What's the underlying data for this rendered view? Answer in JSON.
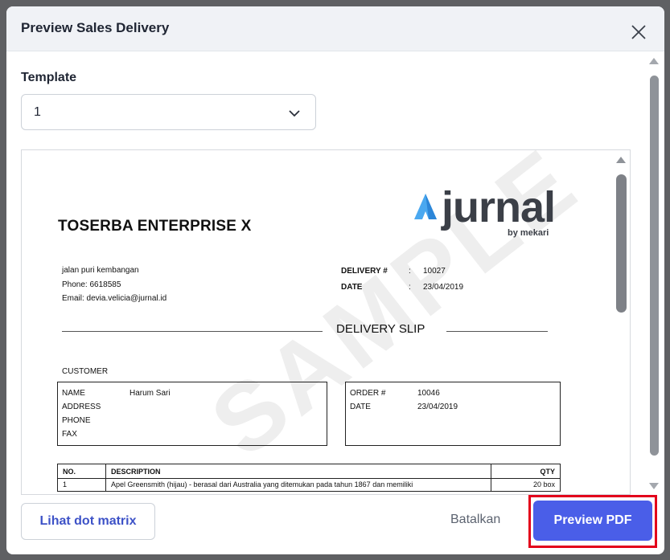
{
  "modal": {
    "title": "Preview Sales Delivery"
  },
  "template": {
    "label": "Template",
    "selected": "1"
  },
  "document": {
    "company": "TOSERBA ENTERPRISE X",
    "logo_word": "jurnal",
    "logo_by": "by mekari",
    "address_lines": [
      "jalan puri kembangan",
      "Phone: 6618585",
      "Email: devia.velicia@jurnal.id"
    ],
    "delivery_no_label": "DELIVERY #",
    "delivery_no": "10027",
    "date_label": "DATE",
    "date": "23/04/2019",
    "colon": ":",
    "slip_title": "DELIVERY SLIP",
    "watermark": "SAMPLE",
    "customer_label": "CUSTOMER",
    "customer": {
      "name_label": "NAME",
      "name": "Harum Sari",
      "address_label": "ADDRESS",
      "phone_label": "PHONE",
      "fax_label": "FAX"
    },
    "order": {
      "order_label": "ORDER #",
      "order_no": "10046",
      "date_label": "DATE",
      "date": "23/04/2019"
    },
    "table": {
      "headers": [
        "NO.",
        "DESCRIPTION",
        "QTY"
      ],
      "rows": [
        [
          "1",
          "Apel Greensmith (hijau) -  berasal dari Australia yang ditemukan pada tahun 1867 dan memiliki",
          "20 box"
        ]
      ]
    }
  },
  "footer": {
    "dot_matrix_label": "Lihat dot matrix",
    "cancel_label": "Batalkan",
    "preview_pdf_label": "Preview PDF"
  },
  "colors": {
    "primary": "#4a5ee8",
    "highlight": "#e3001b",
    "logo_accent": "#4aa8f0"
  }
}
